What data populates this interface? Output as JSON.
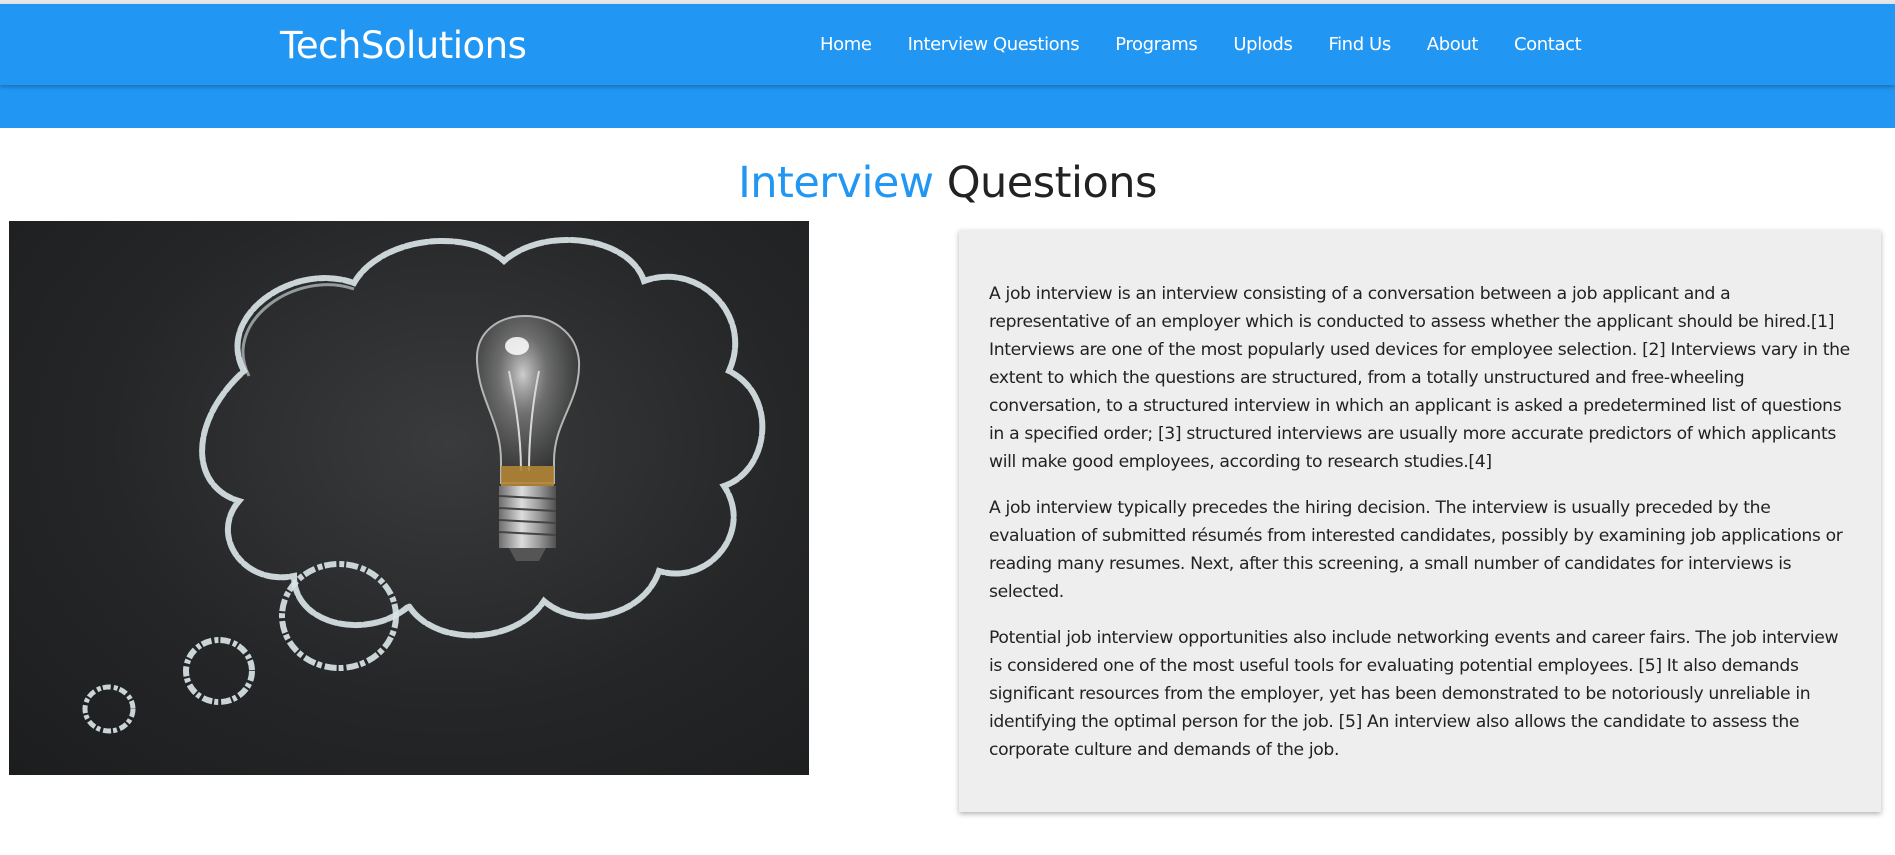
{
  "header": {
    "brand": "TechSolutions",
    "nav": [
      {
        "label": "Home"
      },
      {
        "label": "Interview Questions"
      },
      {
        "label": "Programs"
      },
      {
        "label": "Uplods"
      },
      {
        "label": "Find Us"
      },
      {
        "label": "About"
      },
      {
        "label": "Contact"
      }
    ],
    "colors": {
      "primary": "#2196f3"
    }
  },
  "main": {
    "title_accent": "Interview",
    "title_rest": "Questions",
    "image": {
      "icon": "chalkboard-lightbulb-thought-bubble-image"
    },
    "paragraphs": [
      "A job interview is an interview consisting of a conversation between a job applicant and a representative of an employer which is conducted to assess whether the applicant should be hired.[1] Interviews are one of the most popularly used devices for employee selection. [2] Interviews vary in the extent to which the questions are structured, from a totally unstructured and free-wheeling conversation, to a structured interview in which an applicant is asked a predetermined list of questions in a specified order; [3] structured interviews are usually more accurate predictors of which applicants will make good employees, according to research studies.[4]",
      "A job interview typically precedes the hiring decision. The interview is usually preceded by the evaluation of submitted résumés from interested candidates, possibly by examining job applications or reading many resumes. Next, after this screening, a small number of candidates for interviews is selected.",
      "Potential job interview opportunities also include networking events and career fairs. The job interview is considered one of the most useful tools for evaluating potential employees. [5] It also demands significant resources from the employer, yet has been demonstrated to be notoriously unreliable in identifying the optimal person for the job. [5] An interview also allows the candidate to assess the corporate culture and demands of the job."
    ]
  }
}
